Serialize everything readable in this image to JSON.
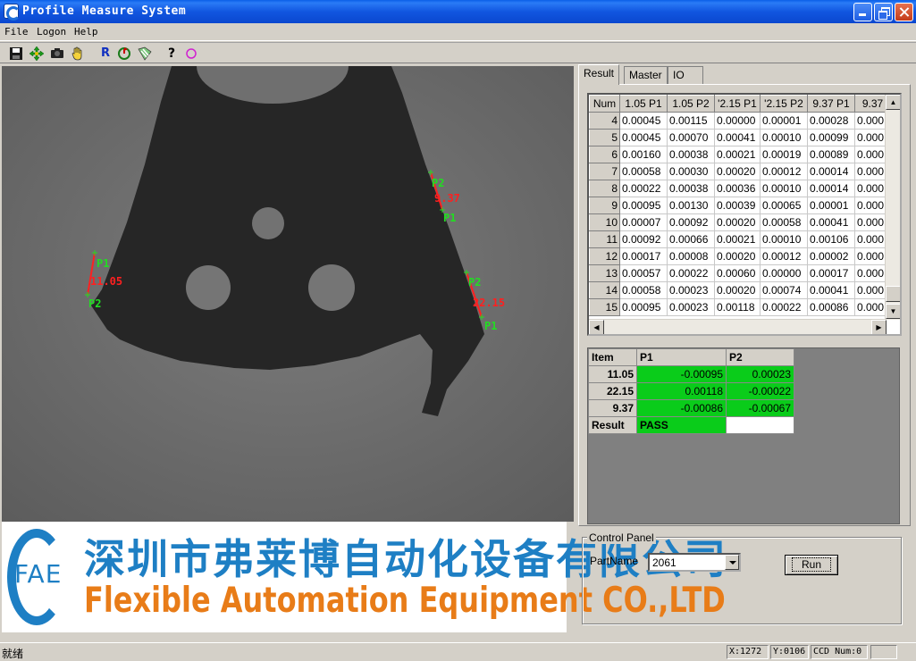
{
  "window": {
    "title": "Profile Measure System"
  },
  "menu": [
    "File",
    "Logon",
    "Help"
  ],
  "toolbar": [
    "save-icon",
    "move-icon",
    "camera-icon",
    "hand-icon",
    "r-icon",
    "rotate-icon",
    "layers-icon",
    "help-icon",
    "circle-icon"
  ],
  "toolbar_r": "R",
  "toolbar_help": "?",
  "overlay": {
    "labels": [
      {
        "text": "P2",
        "color": "#22dd22"
      },
      {
        "text": "9.37",
        "color": "#ff2020"
      },
      {
        "text": "P1",
        "color": "#22dd22"
      },
      {
        "text": "P1",
        "color": "#22dd22"
      },
      {
        "text": "11.05",
        "color": "#ff2020"
      },
      {
        "text": "P2",
        "color": "#22dd22"
      },
      {
        "text": "P2",
        "color": "#22dd22"
      },
      {
        "text": "22.15",
        "color": "#ff2020"
      },
      {
        "text": "P1",
        "color": "#22dd22"
      }
    ]
  },
  "logo": {
    "mark": "FAE",
    "chinese": "深圳市弗莱博自动化设备有限公司",
    "english": "Flexible Automation Equipment CO.,LTD"
  },
  "tabs": [
    "Result",
    "Master",
    "IO"
  ],
  "history_table": {
    "headers": [
      "Num",
      "1.05 P1",
      "1.05 P2",
      "'2.15 P1",
      "'2.15 P2",
      "9.37 P1",
      "9.37"
    ],
    "rows": [
      {
        "num": "4",
        "cells": [
          "0.00045",
          "0.00115",
          "0.00000",
          "0.00001",
          "0.00028",
          "0.000"
        ]
      },
      {
        "num": "5",
        "cells": [
          "0.00045",
          "0.00070",
          "0.00041",
          "0.00010",
          "0.00099",
          "0.000"
        ]
      },
      {
        "num": "6",
        "cells": [
          "0.00160",
          "0.00038",
          "0.00021",
          "0.00019",
          "0.00089",
          "0.000"
        ]
      },
      {
        "num": "7",
        "cells": [
          "0.00058",
          "0.00030",
          "0.00020",
          "0.00012",
          "0.00014",
          "0.000"
        ]
      },
      {
        "num": "8",
        "cells": [
          "0.00022",
          "0.00038",
          "0.00036",
          "0.00010",
          "0.00014",
          "0.000"
        ]
      },
      {
        "num": "9",
        "cells": [
          "0.00095",
          "0.00130",
          "0.00039",
          "0.00065",
          "0.00001",
          "0.000"
        ]
      },
      {
        "num": "10",
        "cells": [
          "0.00007",
          "0.00092",
          "0.00020",
          "0.00058",
          "0.00041",
          "0.000"
        ]
      },
      {
        "num": "11",
        "cells": [
          "0.00092",
          "0.00066",
          "0.00021",
          "0.00010",
          "0.00106",
          "0.000"
        ]
      },
      {
        "num": "12",
        "cells": [
          "0.00017",
          "0.00008",
          "0.00020",
          "0.00012",
          "0.00002",
          "0.000"
        ]
      },
      {
        "num": "13",
        "cells": [
          "0.00057",
          "0.00022",
          "0.00060",
          "0.00000",
          "0.00017",
          "0.000"
        ]
      },
      {
        "num": "14",
        "cells": [
          "0.00058",
          "0.00023",
          "0.00020",
          "0.00074",
          "0.00041",
          "0.000"
        ]
      },
      {
        "num": "15",
        "cells": [
          "0.00095",
          "0.00023",
          "0.00118",
          "0.00022",
          "0.00086",
          "0.000"
        ]
      }
    ]
  },
  "result_table": {
    "headers": [
      "Item",
      "P1",
      "P2"
    ],
    "rows": [
      {
        "item": "11.05",
        "p1": "-0.00095",
        "p2": "0.00023"
      },
      {
        "item": "22.15",
        "p1": "0.00118",
        "p2": "-0.00022"
      },
      {
        "item": "9.37",
        "p1": "-0.00086",
        "p2": "-0.00067"
      }
    ],
    "result_label": "Result",
    "result_value": "PASS"
  },
  "control_panel": {
    "title": "Control Panel",
    "part_label": "PartName",
    "part_value": "2061",
    "run_label": "Run"
  },
  "status": {
    "message": "就绪",
    "x": "X:1272",
    "y": "Y:0106",
    "ccd": "CCD Num:0"
  },
  "colors": {
    "pass": "#0acc1a",
    "titlebar": "#0a5ee8",
    "logo_blue": "#1e7fc4",
    "logo_orange": "#e87c18"
  }
}
